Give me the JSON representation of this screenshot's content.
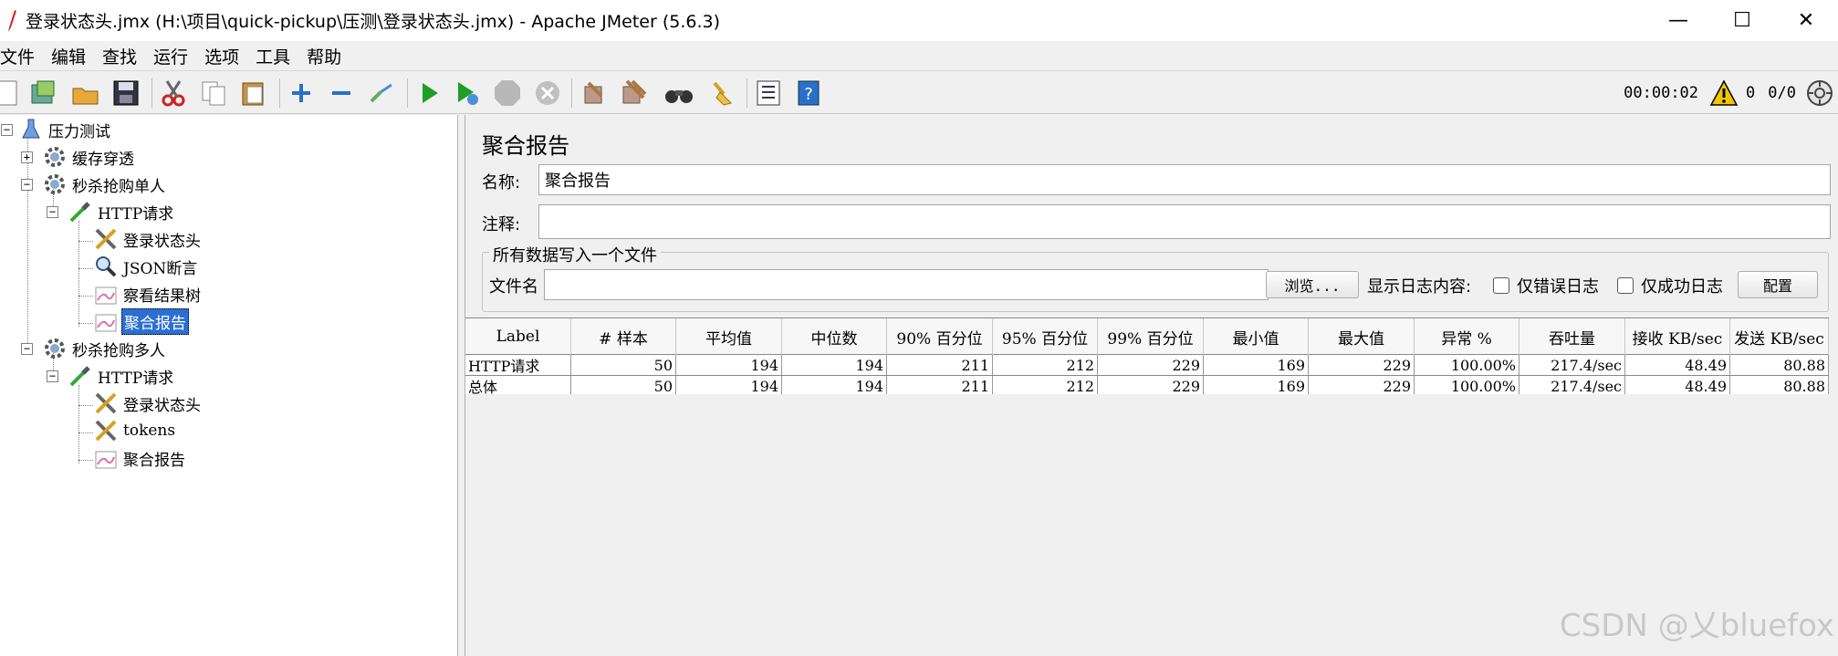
{
  "window": {
    "title": "登录状态头.jmx (H:\\项目\\quick-pickup\\压测\\登录状态头.jmx) - Apache JMeter (5.6.3)",
    "minimize": "—",
    "maximize": "☐",
    "close": "✕"
  },
  "menu": [
    "文件",
    "编辑",
    "查找",
    "运行",
    "选项",
    "工具",
    "帮助"
  ],
  "status": {
    "timer": "00:00:02",
    "warnings": "0",
    "threads": "0/0"
  },
  "tree": {
    "root": "压力测试",
    "nodes": [
      {
        "label": "缓存穿透",
        "icon": "gear-icon"
      },
      {
        "label": "秒杀抢购单人",
        "icon": "gear-icon"
      },
      {
        "label": "HTTP请求",
        "icon": "pipette-icon"
      },
      {
        "label": "登录状态头",
        "icon": "wrench-icon"
      },
      {
        "label": "JSON断言",
        "icon": "magnifier-icon"
      },
      {
        "label": "察看结果树",
        "icon": "graph-icon"
      },
      {
        "label": "聚合报告",
        "icon": "graph-icon"
      },
      {
        "label": "秒杀抢购多人",
        "icon": "gear-icon"
      },
      {
        "label": "HTTP请求",
        "icon": "pipette-icon"
      },
      {
        "label": "登录状态头",
        "icon": "wrench-icon"
      },
      {
        "label": "tokens",
        "icon": "wrench-icon"
      },
      {
        "label": "聚合报告",
        "icon": "graph-icon"
      }
    ]
  },
  "panel": {
    "title": "聚合报告",
    "name_label": "名称:",
    "name_value": "聚合报告",
    "comment_label": "注释:",
    "comment_value": "",
    "file_group_legend": "所有数据写入一个文件",
    "file_label": "文件名",
    "file_value": "",
    "browse_button": "浏览...",
    "log_content_label": "显示日志内容:",
    "errors_only": "仅错误日志",
    "success_only": "仅成功日志",
    "config_button": "配置"
  },
  "table": {
    "columns": [
      "Label",
      "# 样本",
      "平均值",
      "中位数",
      "90% 百分位",
      "95% 百分位",
      "99% 百分位",
      "最小值",
      "最大值",
      "异常 %",
      "吞吐量",
      "接收 KB/sec",
      "发送 KB/sec"
    ],
    "rows": [
      [
        "HTTP请求",
        "50",
        "194",
        "194",
        "211",
        "212",
        "229",
        "169",
        "229",
        "100.00%",
        "217.4/sec",
        "48.49",
        "80.88"
      ],
      [
        "总体",
        "50",
        "194",
        "194",
        "211",
        "212",
        "229",
        "169",
        "229",
        "100.00%",
        "217.4/sec",
        "48.49",
        "80.88"
      ]
    ]
  },
  "watermark": "CSDN @乂bluefox",
  "colors": {
    "selection": "#2c6fd1",
    "play_green": "#1f9e2a",
    "warning_yellow": "#f5c400"
  }
}
